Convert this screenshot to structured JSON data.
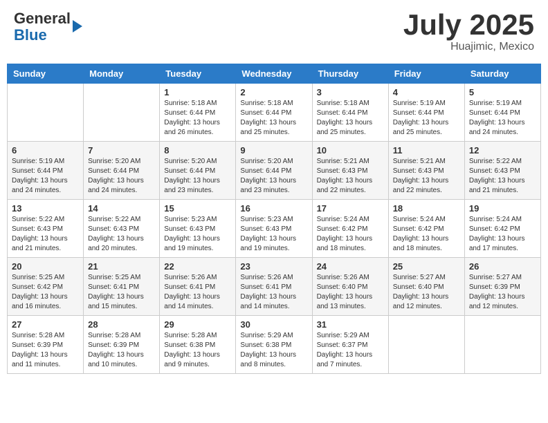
{
  "header": {
    "logo_general": "General",
    "logo_blue": "Blue",
    "month": "July 2025",
    "location": "Huajimic, Mexico"
  },
  "weekdays": [
    "Sunday",
    "Monday",
    "Tuesday",
    "Wednesday",
    "Thursday",
    "Friday",
    "Saturday"
  ],
  "weeks": [
    [
      {
        "day": "",
        "info": ""
      },
      {
        "day": "",
        "info": ""
      },
      {
        "day": "1",
        "info": "Sunrise: 5:18 AM\nSunset: 6:44 PM\nDaylight: 13 hours and 26 minutes."
      },
      {
        "day": "2",
        "info": "Sunrise: 5:18 AM\nSunset: 6:44 PM\nDaylight: 13 hours and 25 minutes."
      },
      {
        "day": "3",
        "info": "Sunrise: 5:18 AM\nSunset: 6:44 PM\nDaylight: 13 hours and 25 minutes."
      },
      {
        "day": "4",
        "info": "Sunrise: 5:19 AM\nSunset: 6:44 PM\nDaylight: 13 hours and 25 minutes."
      },
      {
        "day": "5",
        "info": "Sunrise: 5:19 AM\nSunset: 6:44 PM\nDaylight: 13 hours and 24 minutes."
      }
    ],
    [
      {
        "day": "6",
        "info": "Sunrise: 5:19 AM\nSunset: 6:44 PM\nDaylight: 13 hours and 24 minutes."
      },
      {
        "day": "7",
        "info": "Sunrise: 5:20 AM\nSunset: 6:44 PM\nDaylight: 13 hours and 24 minutes."
      },
      {
        "day": "8",
        "info": "Sunrise: 5:20 AM\nSunset: 6:44 PM\nDaylight: 13 hours and 23 minutes."
      },
      {
        "day": "9",
        "info": "Sunrise: 5:20 AM\nSunset: 6:44 PM\nDaylight: 13 hours and 23 minutes."
      },
      {
        "day": "10",
        "info": "Sunrise: 5:21 AM\nSunset: 6:43 PM\nDaylight: 13 hours and 22 minutes."
      },
      {
        "day": "11",
        "info": "Sunrise: 5:21 AM\nSunset: 6:43 PM\nDaylight: 13 hours and 22 minutes."
      },
      {
        "day": "12",
        "info": "Sunrise: 5:22 AM\nSunset: 6:43 PM\nDaylight: 13 hours and 21 minutes."
      }
    ],
    [
      {
        "day": "13",
        "info": "Sunrise: 5:22 AM\nSunset: 6:43 PM\nDaylight: 13 hours and 21 minutes."
      },
      {
        "day": "14",
        "info": "Sunrise: 5:22 AM\nSunset: 6:43 PM\nDaylight: 13 hours and 20 minutes."
      },
      {
        "day": "15",
        "info": "Sunrise: 5:23 AM\nSunset: 6:43 PM\nDaylight: 13 hours and 19 minutes."
      },
      {
        "day": "16",
        "info": "Sunrise: 5:23 AM\nSunset: 6:43 PM\nDaylight: 13 hours and 19 minutes."
      },
      {
        "day": "17",
        "info": "Sunrise: 5:24 AM\nSunset: 6:42 PM\nDaylight: 13 hours and 18 minutes."
      },
      {
        "day": "18",
        "info": "Sunrise: 5:24 AM\nSunset: 6:42 PM\nDaylight: 13 hours and 18 minutes."
      },
      {
        "day": "19",
        "info": "Sunrise: 5:24 AM\nSunset: 6:42 PM\nDaylight: 13 hours and 17 minutes."
      }
    ],
    [
      {
        "day": "20",
        "info": "Sunrise: 5:25 AM\nSunset: 6:42 PM\nDaylight: 13 hours and 16 minutes."
      },
      {
        "day": "21",
        "info": "Sunrise: 5:25 AM\nSunset: 6:41 PM\nDaylight: 13 hours and 15 minutes."
      },
      {
        "day": "22",
        "info": "Sunrise: 5:26 AM\nSunset: 6:41 PM\nDaylight: 13 hours and 14 minutes."
      },
      {
        "day": "23",
        "info": "Sunrise: 5:26 AM\nSunset: 6:41 PM\nDaylight: 13 hours and 14 minutes."
      },
      {
        "day": "24",
        "info": "Sunrise: 5:26 AM\nSunset: 6:40 PM\nDaylight: 13 hours and 13 minutes."
      },
      {
        "day": "25",
        "info": "Sunrise: 5:27 AM\nSunset: 6:40 PM\nDaylight: 13 hours and 12 minutes."
      },
      {
        "day": "26",
        "info": "Sunrise: 5:27 AM\nSunset: 6:39 PM\nDaylight: 13 hours and 12 minutes."
      }
    ],
    [
      {
        "day": "27",
        "info": "Sunrise: 5:28 AM\nSunset: 6:39 PM\nDaylight: 13 hours and 11 minutes."
      },
      {
        "day": "28",
        "info": "Sunrise: 5:28 AM\nSunset: 6:39 PM\nDaylight: 13 hours and 10 minutes."
      },
      {
        "day": "29",
        "info": "Sunrise: 5:28 AM\nSunset: 6:38 PM\nDaylight: 13 hours and 9 minutes."
      },
      {
        "day": "30",
        "info": "Sunrise: 5:29 AM\nSunset: 6:38 PM\nDaylight: 13 hours and 8 minutes."
      },
      {
        "day": "31",
        "info": "Sunrise: 5:29 AM\nSunset: 6:37 PM\nDaylight: 13 hours and 7 minutes."
      },
      {
        "day": "",
        "info": ""
      },
      {
        "day": "",
        "info": ""
      }
    ]
  ]
}
